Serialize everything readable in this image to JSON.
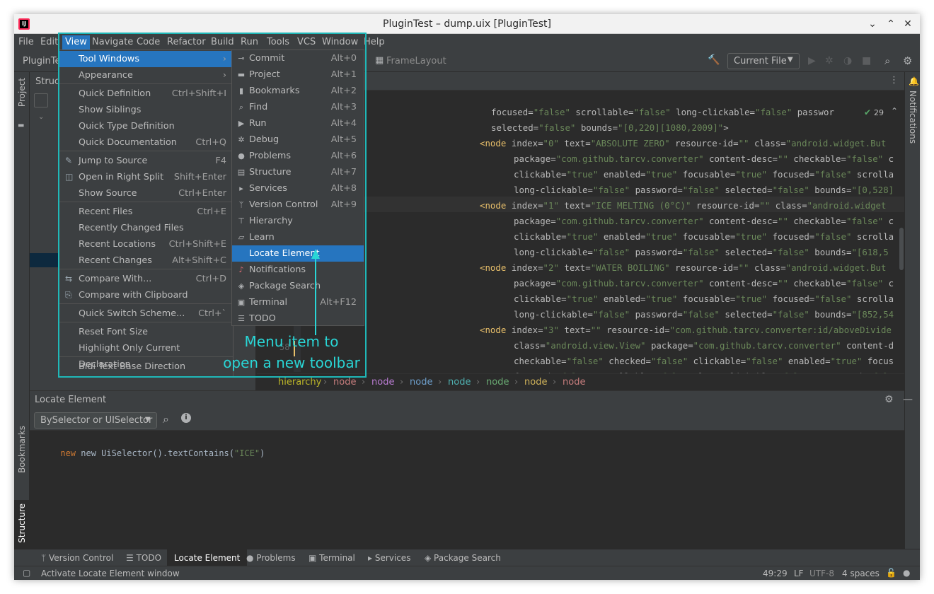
{
  "window": {
    "title": "PluginTest – dump.uix [PluginTest]",
    "app_icon": "IJ"
  },
  "menubar": {
    "items": [
      "File",
      "Edit",
      "View",
      "Navigate",
      "Code",
      "Refactor",
      "Build",
      "Run",
      "Tools",
      "VCS",
      "Window",
      "Help"
    ]
  },
  "toolbar": {
    "project": "PluginTes",
    "breadcrumb_item": "FrameLayout",
    "run_config": "Current File",
    "icon_hammer": "hammer-icon",
    "icon_search": "search-icon",
    "icon_settings": "gear-icon"
  },
  "side": {
    "project": "Project",
    "bookmarks": "Bookmarks",
    "structure": "Structure",
    "notifications": "Notifications"
  },
  "structure_panel": {
    "title": "Structu"
  },
  "view_menu": {
    "items": [
      {
        "label": "Tool Windows",
        "shortcut": "",
        "submenu": true,
        "selected": true
      },
      {
        "label": "Appearance",
        "shortcut": "",
        "submenu": true
      },
      {
        "label": "Quick Definition",
        "shortcut": "Ctrl+Shift+I"
      },
      {
        "label": "Show Siblings",
        "shortcut": ""
      },
      {
        "label": "Quick Type Definition",
        "shortcut": ""
      },
      {
        "label": "Quick Documentation",
        "shortcut": "Ctrl+Q"
      },
      {
        "label": "Jump to Source",
        "shortcut": "F4"
      },
      {
        "label": "Open in Right Split",
        "shortcut": "Shift+Enter"
      },
      {
        "label": "Show Source",
        "shortcut": "Ctrl+Enter"
      },
      {
        "label": "Recent Files",
        "shortcut": "Ctrl+E"
      },
      {
        "label": "Recently Changed Files",
        "shortcut": ""
      },
      {
        "label": "Recent Locations",
        "shortcut": "Ctrl+Shift+E"
      },
      {
        "label": "Recent Changes",
        "shortcut": "Alt+Shift+C"
      },
      {
        "label": "Compare With...",
        "shortcut": "Ctrl+D"
      },
      {
        "label": "Compare with Clipboard",
        "shortcut": ""
      },
      {
        "label": "Quick Switch Scheme...",
        "shortcut": "Ctrl+`"
      },
      {
        "label": "Reset Font Size",
        "shortcut": ""
      },
      {
        "label": "Highlight Only Current Declaration",
        "shortcut": ""
      },
      {
        "label": "Bidi Text Base Direction",
        "shortcut": ""
      }
    ]
  },
  "tool_windows_menu": {
    "items": [
      {
        "label": "Commit",
        "shortcut": "Alt+0",
        "icon": "commit-icon"
      },
      {
        "label": "Project",
        "shortcut": "Alt+1",
        "icon": "folder-icon"
      },
      {
        "label": "Bookmarks",
        "shortcut": "Alt+2",
        "icon": "bookmark-icon"
      },
      {
        "label": "Find",
        "shortcut": "Alt+3",
        "icon": "find-icon"
      },
      {
        "label": "Run",
        "shortcut": "Alt+4",
        "icon": "run-icon"
      },
      {
        "label": "Debug",
        "shortcut": "Alt+5",
        "icon": "debug-icon"
      },
      {
        "label": "Problems",
        "shortcut": "Alt+6",
        "icon": "problems-icon"
      },
      {
        "label": "Structure",
        "shortcut": "Alt+7",
        "icon": "structure-icon"
      },
      {
        "label": "Services",
        "shortcut": "Alt+8",
        "icon": "services-icon"
      },
      {
        "label": "Version Control",
        "shortcut": "Alt+9",
        "icon": "vcs-icon"
      },
      {
        "label": "Hierarchy",
        "shortcut": "",
        "icon": "hierarchy-icon"
      },
      {
        "label": "Learn",
        "shortcut": "",
        "icon": "learn-icon"
      },
      {
        "label": "Locate Element",
        "shortcut": "",
        "icon": "",
        "selected": true
      },
      {
        "label": "Notifications",
        "shortcut": "",
        "icon": "bell-icon"
      },
      {
        "label": "Package Search",
        "shortcut": "",
        "icon": "package-icon"
      },
      {
        "label": "Terminal",
        "shortcut": "Alt+F12",
        "icon": "terminal-icon"
      },
      {
        "label": "TODO",
        "shortcut": "",
        "icon": "todo-icon"
      }
    ]
  },
  "annotation": {
    "line1": "Menu item to",
    "line2": "open a new toolbar"
  },
  "editor": {
    "inspection": "29",
    "gutter_line": "58",
    "lines": [
      {
        "indent": 1,
        "parts": [
          [
            "a",
            "focused="
          ],
          [
            "v",
            "\"false\""
          ],
          [
            "a",
            " scrollable="
          ],
          [
            "v",
            "\"false\""
          ],
          [
            "a",
            " long-clickable="
          ],
          [
            "v",
            "\"false\""
          ],
          [
            "a",
            " passwor"
          ]
        ]
      },
      {
        "indent": 1,
        "parts": [
          [
            "a",
            "selected="
          ],
          [
            "v",
            "\"false\""
          ],
          [
            "a",
            " bounds="
          ],
          [
            "v",
            "\"[0,220][1080,2009]\""
          ],
          [
            "a",
            ">"
          ]
        ]
      },
      {
        "indent": 0,
        "parts": [
          [
            "t",
            "<node"
          ],
          [
            "a",
            " index="
          ],
          [
            "v",
            "\"0\""
          ],
          [
            "a",
            " text="
          ],
          [
            "v",
            "\"ABSOLUTE ZERO\""
          ],
          [
            "a",
            " resource-id="
          ],
          [
            "v",
            "\"\""
          ],
          [
            "a",
            " class="
          ],
          [
            "v",
            "\"android.widget.But"
          ]
        ]
      },
      {
        "indent": 2,
        "parts": [
          [
            "a",
            "package="
          ],
          [
            "v",
            "\"com.github.tarcv.converter\""
          ],
          [
            "a",
            " content-desc="
          ],
          [
            "v",
            "\"\""
          ],
          [
            "a",
            " checkable="
          ],
          [
            "v",
            "\"false\""
          ],
          [
            "a",
            " c"
          ]
        ]
      },
      {
        "indent": 2,
        "parts": [
          [
            "a",
            "clickable="
          ],
          [
            "v",
            "\"true\""
          ],
          [
            "a",
            " enabled="
          ],
          [
            "v",
            "\"true\""
          ],
          [
            "a",
            " focusable="
          ],
          [
            "v",
            "\"true\""
          ],
          [
            "a",
            " focused="
          ],
          [
            "v",
            "\"false\""
          ],
          [
            "a",
            " scrolla"
          ]
        ]
      },
      {
        "indent": 2,
        "parts": [
          [
            "a",
            "long-clickable="
          ],
          [
            "v",
            "\"false\""
          ],
          [
            "a",
            " password="
          ],
          [
            "v",
            "\"false\""
          ],
          [
            "a",
            " selected="
          ],
          [
            "v",
            "\"false\""
          ],
          [
            "a",
            " bounds="
          ],
          [
            "v",
            "\"[0,528]"
          ]
        ]
      },
      {
        "indent": 0,
        "parts": [
          [
            "t",
            "<node"
          ],
          [
            "a",
            " index="
          ],
          [
            "v",
            "\"1\""
          ],
          [
            "a",
            " text="
          ],
          [
            "v",
            "\"ICE MELTING (0°C)\""
          ],
          [
            "a",
            " resource-id="
          ],
          [
            "v",
            "\"\""
          ],
          [
            "a",
            " class="
          ],
          [
            "v",
            "\"android.widget"
          ]
        ]
      },
      {
        "indent": 2,
        "parts": [
          [
            "a",
            "package="
          ],
          [
            "v",
            "\"com.github.tarcv.converter\""
          ],
          [
            "a",
            " content-desc="
          ],
          [
            "v",
            "\"\""
          ],
          [
            "a",
            " checkable="
          ],
          [
            "v",
            "\"false\""
          ],
          [
            "a",
            " c"
          ]
        ]
      },
      {
        "indent": 2,
        "parts": [
          [
            "a",
            "clickable="
          ],
          [
            "v",
            "\"true\""
          ],
          [
            "a",
            " enabled="
          ],
          [
            "v",
            "\"true\""
          ],
          [
            "a",
            " focusable="
          ],
          [
            "v",
            "\"true\""
          ],
          [
            "a",
            " focused="
          ],
          [
            "v",
            "\"false\""
          ],
          [
            "a",
            " scrolla"
          ]
        ]
      },
      {
        "indent": 2,
        "parts": [
          [
            "a",
            "long-clickable="
          ],
          [
            "v",
            "\"false\""
          ],
          [
            "a",
            " password="
          ],
          [
            "v",
            "\"false\""
          ],
          [
            "a",
            " selected="
          ],
          [
            "v",
            "\"false\""
          ],
          [
            "a",
            " bounds="
          ],
          [
            "v",
            "\"[618,5"
          ]
        ]
      },
      {
        "indent": 0,
        "parts": [
          [
            "t",
            "<node"
          ],
          [
            "a",
            " index="
          ],
          [
            "v",
            "\"2\""
          ],
          [
            "a",
            " text="
          ],
          [
            "v",
            "\"WATER BOILING\""
          ],
          [
            "a",
            " resource-id="
          ],
          [
            "v",
            "\"\""
          ],
          [
            "a",
            " class="
          ],
          [
            "v",
            "\"android.widget.But"
          ]
        ]
      },
      {
        "indent": 2,
        "parts": [
          [
            "a",
            "package="
          ],
          [
            "v",
            "\"com.github.tarcv.converter\""
          ],
          [
            "a",
            " content-desc="
          ],
          [
            "v",
            "\"\""
          ],
          [
            "a",
            " checkable="
          ],
          [
            "v",
            "\"false\""
          ],
          [
            "a",
            " c"
          ]
        ]
      },
      {
        "indent": 2,
        "parts": [
          [
            "a",
            "clickable="
          ],
          [
            "v",
            "\"true\""
          ],
          [
            "a",
            " enabled="
          ],
          [
            "v",
            "\"true\""
          ],
          [
            "a",
            " focusable="
          ],
          [
            "v",
            "\"true\""
          ],
          [
            "a",
            " focused="
          ],
          [
            "v",
            "\"false\""
          ],
          [
            "a",
            " scrolla"
          ]
        ]
      },
      {
        "indent": 2,
        "parts": [
          [
            "a",
            "long-clickable="
          ],
          [
            "v",
            "\"false\""
          ],
          [
            "a",
            " password="
          ],
          [
            "v",
            "\"false\""
          ],
          [
            "a",
            " selected="
          ],
          [
            "v",
            "\"false\""
          ],
          [
            "a",
            " bounds="
          ],
          [
            "v",
            "\"[852,54"
          ]
        ]
      },
      {
        "indent": 0,
        "parts": [
          [
            "t",
            "<node"
          ],
          [
            "a",
            " index="
          ],
          [
            "v",
            "\"3\""
          ],
          [
            "a",
            " text="
          ],
          [
            "v",
            "\"\""
          ],
          [
            "a",
            " resource-id="
          ],
          [
            "v",
            "\"com.github.tarcv.converter:id/aboveDivide"
          ]
        ]
      },
      {
        "indent": 2,
        "parts": [
          [
            "a",
            "class="
          ],
          [
            "v",
            "\"android.view.View\""
          ],
          [
            "a",
            " package="
          ],
          [
            "v",
            "\"com.github.tarcv.converter\""
          ],
          [
            "a",
            " content-d"
          ]
        ]
      },
      {
        "indent": 2,
        "parts": [
          [
            "a",
            "checkable="
          ],
          [
            "v",
            "\"false\""
          ],
          [
            "a",
            " checked="
          ],
          [
            "v",
            "\"false\""
          ],
          [
            "a",
            " clickable="
          ],
          [
            "v",
            "\"false\""
          ],
          [
            "a",
            " enabled="
          ],
          [
            "v",
            "\"true\""
          ],
          [
            "a",
            " focus"
          ]
        ]
      },
      {
        "indent": 2,
        "parts": [
          [
            "a",
            "focused="
          ],
          [
            "v",
            "\"false\""
          ],
          [
            "a",
            " scrollable="
          ],
          [
            "v",
            "\"false\""
          ],
          [
            "a",
            " long-clickable="
          ],
          [
            "v",
            "\"false\""
          ],
          [
            "a",
            " password="
          ],
          [
            "v",
            "\"fals"
          ]
        ]
      }
    ]
  },
  "breadcrumbs": {
    "items": [
      {
        "label": "hierarchy",
        "color": "#bbb529"
      },
      {
        "label": "node",
        "color": "#c77d7d"
      },
      {
        "label": "node",
        "color": "#b87bd1"
      },
      {
        "label": "node",
        "color": "#6e9fcc"
      },
      {
        "label": "node",
        "color": "#4fb0b0"
      },
      {
        "label": "node",
        "color": "#6aab73"
      },
      {
        "label": "node",
        "color": "#d2b45a"
      },
      {
        "label": "node",
        "color": "#c77d7d"
      }
    ]
  },
  "locate": {
    "title": "Locate Element",
    "selector": "BySelector or UISelector",
    "query_prefix": "new UiSelector().textContains(",
    "query_arg": "\"ICE\"",
    "query_suffix": ")"
  },
  "bottom_tabs": [
    "Version Control",
    "TODO",
    "Locate Element",
    "Problems",
    "Terminal",
    "Services",
    "Package Search"
  ],
  "status": {
    "message": "Activate Locate Element window",
    "position": "49:29",
    "line_sep": "LF",
    "encoding": "UTF-8",
    "indent": "4 spaces"
  },
  "colors": {
    "accent": "#2675bf",
    "annotation": "#1fb8b8",
    "background": "#2b2b2b",
    "panel": "#3c3f41"
  }
}
